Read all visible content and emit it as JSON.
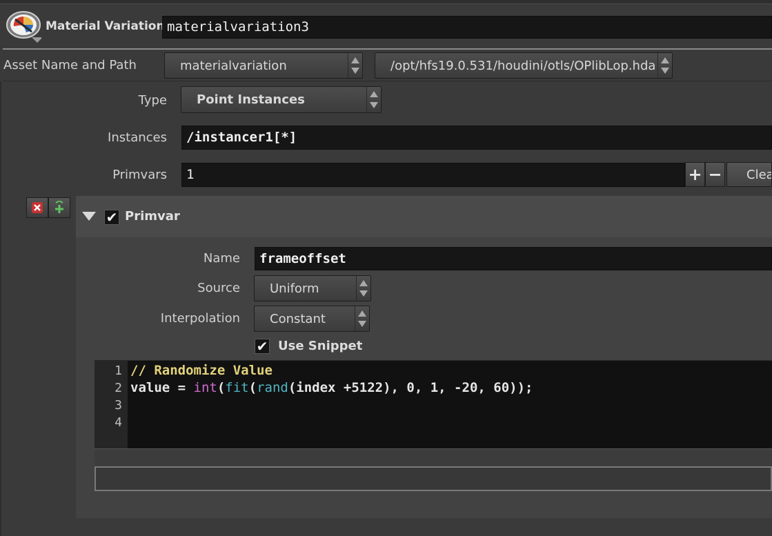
{
  "node": {
    "type_label": "Material Variation",
    "name": "materialvariation3",
    "icon": "material-variation-node-icon"
  },
  "asset": {
    "label": "Asset Name and Path",
    "name": "materialvariation",
    "path": "/opt/hfs19.0.531/houdini/otls/OPlibLop.hda"
  },
  "params": {
    "type": {
      "label": "Type",
      "value": "Point Instances"
    },
    "instances": {
      "label": "Instances",
      "value": "/instancer1[*]"
    },
    "primvars": {
      "label": "Primvars",
      "value": "1",
      "plus": "+",
      "minus": "−",
      "clear": "Clea"
    }
  },
  "primvar": {
    "title": "Primvar",
    "name": {
      "label": "Name",
      "value": "frameoffset"
    },
    "source": {
      "label": "Source",
      "value": "Uniform"
    },
    "interpolation": {
      "label": "Interpolation",
      "value": "Constant"
    },
    "use_snippet": {
      "label": "Use Snippet",
      "checked": true
    }
  },
  "code": {
    "line_numbers": [
      "1",
      "2",
      "3",
      "4"
    ],
    "line1": "// Randomize Value",
    "line2_tokens": {
      "a": "value = ",
      "int": "int",
      "b": "(",
      "fit": "fit",
      "c": "(",
      "rand": "rand",
      "d": "(index +5122), 0, 1, -20, 60));"
    }
  },
  "colors": {
    "background": "#3a3a3a",
    "field": "#161616",
    "comment": "#e3d37a",
    "keyword_int": "#d26ad0",
    "function": "#4fb6c4"
  }
}
